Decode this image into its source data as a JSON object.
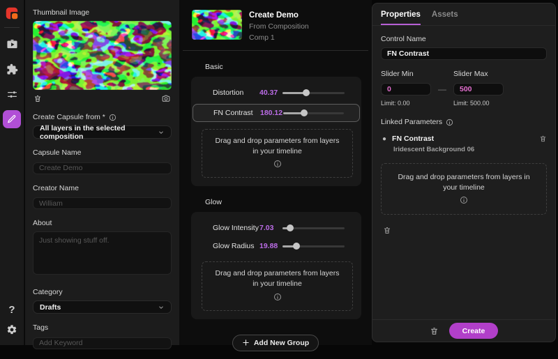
{
  "colors": {
    "accent_purple": "#b14fd6",
    "slider_value_purple": "#bb6ce6",
    "range_value_pink": "#e570d0",
    "create_button_magenta": "#b13fc9",
    "logo_red": "#e5352b",
    "logo_orange": "#f26a1b"
  },
  "rail": {
    "logo_icon": "app-logo",
    "items": [
      {
        "icon": "video-library-icon",
        "active": false
      },
      {
        "icon": "puzzle-icon",
        "active": false
      },
      {
        "icon": "tune-sliders-icon",
        "active": false
      },
      {
        "icon": "capsule-edit-icon",
        "active": true
      }
    ],
    "help_glyph": "?",
    "bottom_icons": [
      "help-icon",
      "gear-icon"
    ]
  },
  "left_panel": {
    "thumbnail_label": "Thumbnail Image",
    "thumbnail_icons": [
      "trash-icon",
      "camera-icon"
    ],
    "create_capsule_from_label": "Create Capsule from *",
    "create_capsule_from_value": "All layers in the selected composition",
    "capsule_name_label": "Capsule Name",
    "capsule_name_placeholder": "Create Demo",
    "creator_name_label": "Creator Name",
    "creator_name_placeholder": "William",
    "about_label": "About",
    "about_placeholder": "Just showing stuff off.",
    "category_label": "Category",
    "category_value": "Drafts",
    "tags_label": "Tags",
    "tags_placeholder": "Add Keyword"
  },
  "mid_panel": {
    "title": "Create Demo",
    "subtitle": "From Composition",
    "comp": "Comp 1",
    "drag_hint": "Drag and drop parameters from layers in your timeline",
    "groups": [
      {
        "name": "Basic",
        "params": [
          {
            "label": "Distortion",
            "value": "40.37",
            "percent": 38,
            "selected": false
          },
          {
            "label": "FN Contrast",
            "value": "180.12",
            "percent": 34,
            "selected": true
          }
        ]
      },
      {
        "name": "Glow",
        "params": [
          {
            "label": "Glow Intensity",
            "value": "7.03",
            "percent": 12,
            "selected": false
          },
          {
            "label": "Glow Radius",
            "value": "19.88",
            "percent": 23,
            "selected": false
          }
        ]
      }
    ],
    "add_group_label": "Add New Group"
  },
  "right_panel": {
    "tabs": [
      "Properties",
      "Assets"
    ],
    "active_tab": "Properties",
    "control_name_label": "Control Name",
    "control_name_value": "FN Contrast",
    "slider_min_label": "Slider Min",
    "slider_min_value": "0",
    "slider_min_limit": "Limit: 0.00",
    "range_separator": "—",
    "slider_max_label": "Slider Max",
    "slider_max_value": "500",
    "slider_max_limit": "Limit: 500.00",
    "linked_parameters_label": "Linked Parameters",
    "linked": [
      {
        "bullet": "●",
        "name": "FN Contrast",
        "source": "Iridescent Background 06"
      }
    ],
    "drag_hint": "Drag and drop parameters from layers in your timeline",
    "create_label": "Create"
  }
}
